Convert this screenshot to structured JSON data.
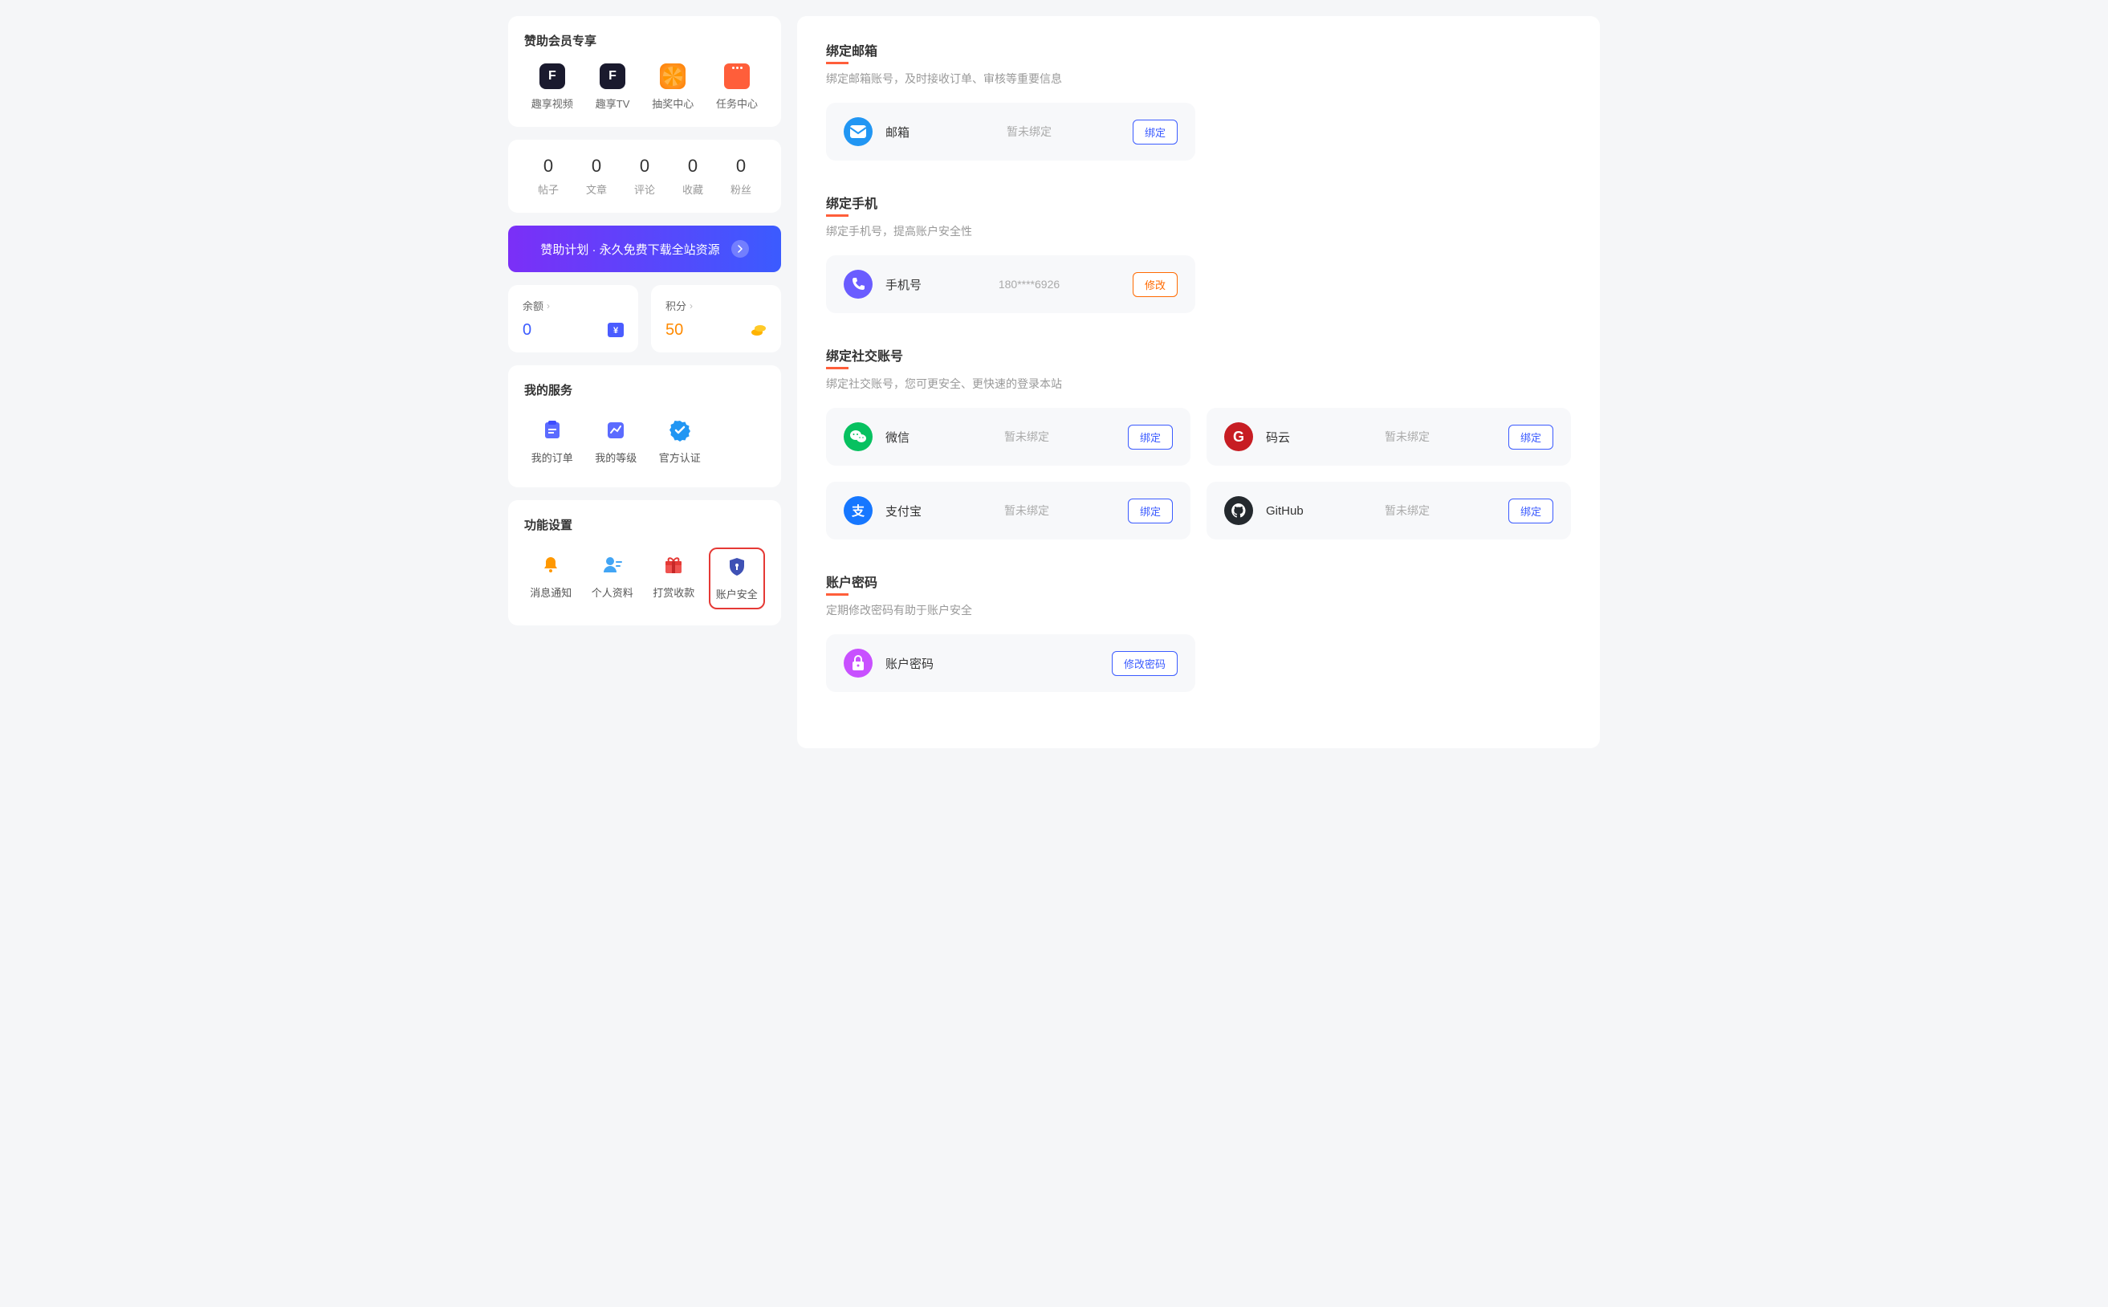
{
  "sidebar": {
    "member_title": "赞助会员专享",
    "member_items": [
      {
        "label": "趣享视频"
      },
      {
        "label": "趣享TV"
      },
      {
        "label": "抽奖中心"
      },
      {
        "label": "任务中心"
      }
    ],
    "stats": [
      {
        "value": "0",
        "label": "帖子"
      },
      {
        "value": "0",
        "label": "文章"
      },
      {
        "value": "0",
        "label": "评论"
      },
      {
        "value": "0",
        "label": "收藏"
      },
      {
        "value": "0",
        "label": "粉丝"
      }
    ],
    "sponsor_text": "赞助计划 · 永久免费下载全站资源",
    "balance": {
      "label": "余额",
      "value": "0"
    },
    "points": {
      "label": "积分",
      "value": "50"
    },
    "services_title": "我的服务",
    "services": [
      {
        "label": "我的订单"
      },
      {
        "label": "我的等级"
      },
      {
        "label": "官方认证"
      }
    ],
    "settings_title": "功能设置",
    "settings": [
      {
        "label": "消息通知"
      },
      {
        "label": "个人资料"
      },
      {
        "label": "打赏收款"
      },
      {
        "label": "账户安全"
      }
    ]
  },
  "main": {
    "sections": {
      "email": {
        "title": "绑定邮箱",
        "desc": "绑定邮箱账号，及时接收订单、审核等重要信息",
        "item": {
          "name": "邮箱",
          "status": "暂未绑定",
          "action": "绑定"
        }
      },
      "phone": {
        "title": "绑定手机",
        "desc": "绑定手机号，提高账户安全性",
        "item": {
          "name": "手机号",
          "status": "180****6926",
          "action": "修改"
        }
      },
      "social": {
        "title": "绑定社交账号",
        "desc": "绑定社交账号，您可更安全、更快速的登录本站",
        "items": [
          {
            "name": "微信",
            "status": "暂未绑定",
            "action": "绑定"
          },
          {
            "name": "码云",
            "status": "暂未绑定",
            "action": "绑定"
          },
          {
            "name": "支付宝",
            "status": "暂未绑定",
            "action": "绑定"
          },
          {
            "name": "GitHub",
            "status": "暂未绑定",
            "action": "绑定"
          }
        ]
      },
      "password": {
        "title": "账户密码",
        "desc": "定期修改密码有助于账户安全",
        "item": {
          "name": "账户密码",
          "action": "修改密码"
        }
      }
    }
  }
}
